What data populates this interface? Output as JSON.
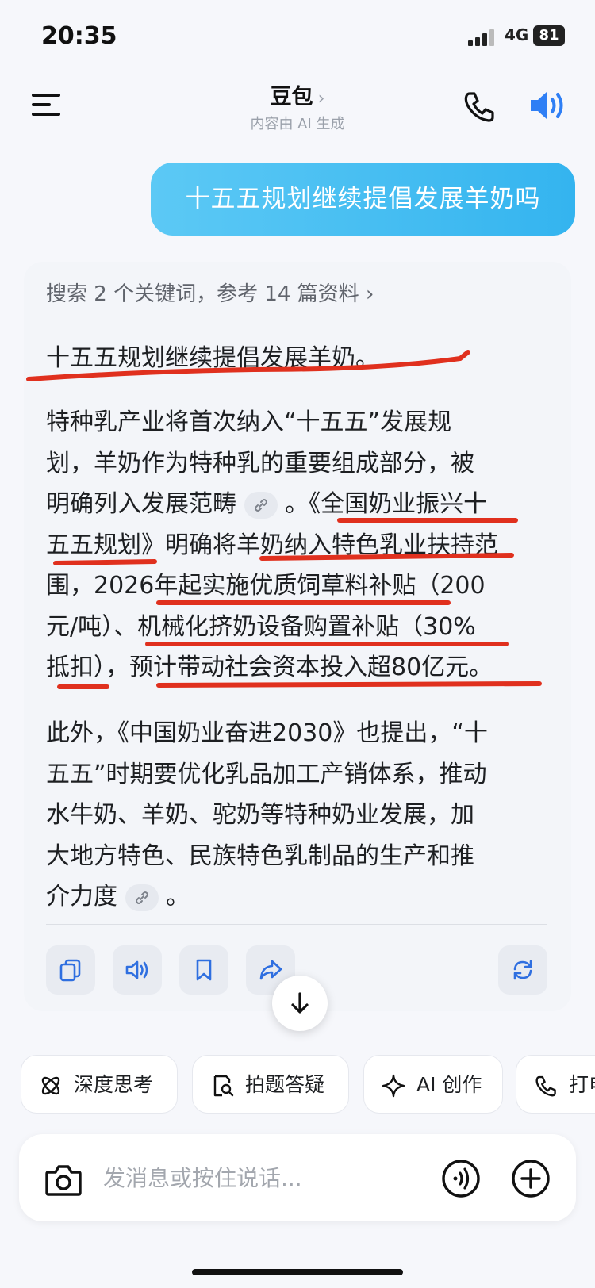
{
  "status_bar": {
    "time": "20:35",
    "network": "4G",
    "battery": "81"
  },
  "header": {
    "title": "豆包",
    "chevron": "›",
    "subtitle": "内容由 AI 生成"
  },
  "icons": {
    "menu": "menu-icon",
    "call": "phone-icon",
    "voice": "speaker-icon",
    "camera": "camera-icon",
    "add": "plus-icon"
  },
  "user_message": "十五五规划继续提倡发展羊奶吗",
  "answer": {
    "search_meta": "搜索 2 个关键词，参考 14 篇资料 ›",
    "headline": "十五五规划继续提倡发展羊奶。",
    "para1_lines": [
      "特种乳产业将首次纳入“十五五”发展规",
      "划，羊奶作为特种乳的重要组成部分，被",
      "明确列入发展范畴",
      "。《全国奶业振兴十",
      "五五规划》明确将羊奶纳入特色乳业扶持范",
      "围，2026年起实施优质饲草料补贴（200",
      "元/吨）、机械化挤奶设备购置补贴（30%",
      "抵扣），预计带动社会资本投入超80亿元。"
    ],
    "para2_lines": [
      "此外，《中国奶业奋进2030》也提出，“十",
      "五五”时期要优化乳品加工产销体系，推动",
      "水牛奶、羊奶、驼奶等特种奶业发展，加",
      "大地方特色、民族特色乳制品的生产和推",
      "介力度",
      "。"
    ]
  },
  "quick_actions": [
    "深度思考",
    "拍题答疑",
    "AI 创作",
    "打电"
  ],
  "input": {
    "placeholder": "发消息或按住说话..."
  },
  "colors": {
    "accent": "#3fb8f0",
    "annotation": "#e0301e"
  }
}
